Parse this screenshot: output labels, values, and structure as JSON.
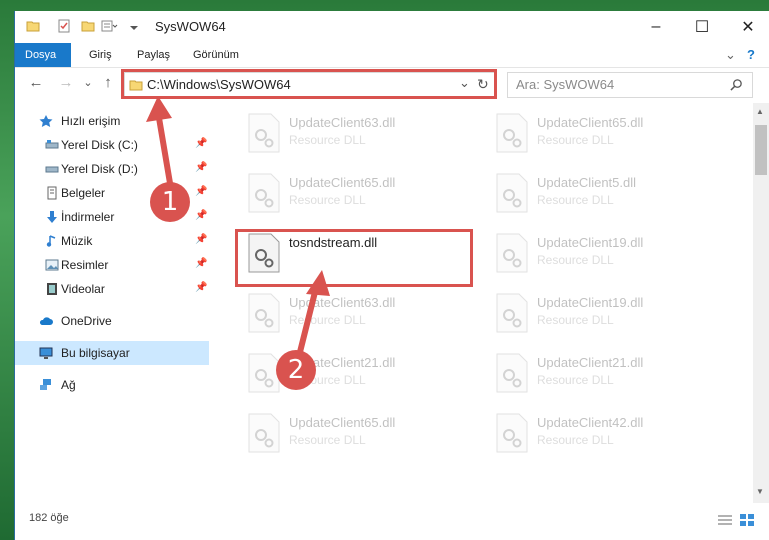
{
  "window": {
    "title": "SysWOW64",
    "minimize": "–",
    "maximize": "☐",
    "close": "✕"
  },
  "ribbon": {
    "tabs": [
      {
        "label": "Dosya"
      },
      {
        "label": "Giriş"
      },
      {
        "label": "Paylaş"
      },
      {
        "label": "Görünüm"
      }
    ],
    "expand": "⌄",
    "help": "?"
  },
  "nav": {
    "back": "←",
    "forward": "→",
    "recent": "⌄",
    "up": "↑",
    "address": "C:\\Windows\\SysWOW64",
    "dropdown": "⌄",
    "refresh": "↻"
  },
  "search": {
    "placeholder": "Ara: SysWOW64"
  },
  "sidebar": {
    "quick_access": "Hızlı erişim",
    "items": [
      {
        "label": "Yerel Disk (C:)"
      },
      {
        "label": "Yerel Disk (D:)"
      },
      {
        "label": "Belgeler"
      },
      {
        "label": "İndirmeler"
      },
      {
        "label": "Müzik"
      },
      {
        "label": "Resimler"
      },
      {
        "label": "Videolar"
      }
    ],
    "onedrive": "OneDrive",
    "this_pc": "Bu bilgisayar",
    "network": "Ağ"
  },
  "files": [
    {
      "name": "UpdateClient63.dll",
      "type": "Resource DLL"
    },
    {
      "name": "UpdateClient65.dll",
      "type": "Resource DLL"
    },
    {
      "name": "UpdateClient65.dll",
      "type": "Resource DLL"
    },
    {
      "name": "UpdateClient5.dll",
      "type": "Resource DLL"
    },
    {
      "name": "tosndstream.dll",
      "type": ""
    },
    {
      "name": "UpdateClient19.dll",
      "type": "Resource DLL"
    },
    {
      "name": "UpdateClient63.dll",
      "type": "Resource DLL"
    },
    {
      "name": "UpdateClient19.dll",
      "type": "Resource DLL"
    },
    {
      "name": "UpdateClient21.dll",
      "type": "Resource DLL"
    },
    {
      "name": "UpdateClient21.dll",
      "type": "Resource DLL"
    },
    {
      "name": "UpdateClient65.dll",
      "type": "Resource DLL"
    },
    {
      "name": "UpdateClient42.dll",
      "type": "Resource DLL"
    }
  ],
  "status": {
    "count": "182 öğe"
  },
  "callouts": {
    "one": "1",
    "two": "2"
  },
  "colors": {
    "accent": "#1979ca",
    "highlight": "#d9534f",
    "selected": "#cce8ff"
  }
}
